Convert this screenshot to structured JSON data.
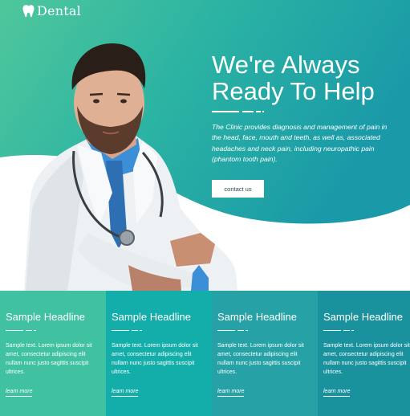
{
  "brand": {
    "name": "Dental",
    "icon": "tooth-icon"
  },
  "hero": {
    "headline_line1": "We're Always",
    "headline_line2": "Ready To Help",
    "description": "The Clinic provides diagnosis and management of pain in the head, face, mouth and teeth, as well as, associated headaches and neck pain, including neuropathic pain (phantom tooth pain).",
    "button_label": "contact us"
  },
  "colors": {
    "teal_light": "#45c4a0",
    "teal_dark": "#1e9ea7",
    "card_colors": [
      "#3fc1a2",
      "#14aeaa",
      "#26a2a6",
      "#1a929e"
    ]
  },
  "cards": [
    {
      "title": "Sample Headline",
      "text": "Sample text. Lorem ipsum dolor sit amet, consectetur adipiscing elit nullam nunc justo sagittis suscipit ultrices.",
      "link": "learn more"
    },
    {
      "title": "Sample Headline",
      "text": "Sample text. Lorem ipsum dolor sit amet, consectetur adipiscing elit nullam nunc justo sagittis suscipit ultrices.",
      "link": "learn more"
    },
    {
      "title": "Sample Headline",
      "text": "Sample text. Lorem ipsum dolor sit amet, consectetur adipiscing elit nullam nunc justo sagittis suscipit ultrices.",
      "link": "learn more"
    },
    {
      "title": "Sample Headline",
      "text": "Sample text. Lorem ipsum dolor sit amet, consectetur adipiscing elit nullam nunc justo sagittis suscipit ultrices.",
      "link": "learn more"
    }
  ]
}
